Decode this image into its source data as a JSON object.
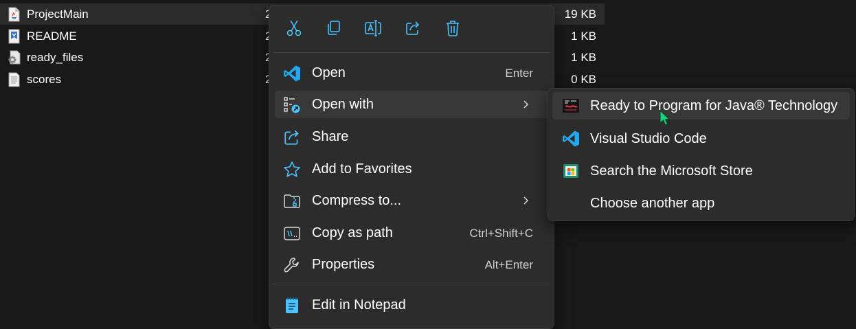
{
  "colors": {
    "background": "#191919",
    "menu_bg": "#2c2c2c",
    "hover_bg": "#383838",
    "vscode_blue": "#23a9f2",
    "icon_accent": "#4cc2ff",
    "cursor": "#17d47b"
  },
  "files": [
    {
      "name": "ProjectMain",
      "date": "2",
      "size": "19 KB",
      "icon": "java-file-icon",
      "selected": true
    },
    {
      "name": "README",
      "date": "2",
      "size": "1 KB",
      "icon": "readme-file-icon",
      "selected": false
    },
    {
      "name": "ready_files",
      "date": "2",
      "size": "1 KB",
      "icon": "settings-file-icon",
      "selected": false
    },
    {
      "name": "scores",
      "date": "2",
      "size": "0 KB",
      "icon": "text-file-icon",
      "selected": false
    }
  ],
  "toolbar": [
    {
      "name": "cut",
      "icon": "scissors-icon"
    },
    {
      "name": "copy",
      "icon": "copy-icon"
    },
    {
      "name": "rename",
      "icon": "rename-icon"
    },
    {
      "name": "share",
      "icon": "share-icon"
    },
    {
      "name": "delete",
      "icon": "trash-icon"
    }
  ],
  "menu": {
    "open": {
      "label": "Open",
      "shortcut": "Enter",
      "icon": "vscode-icon"
    },
    "open_with": {
      "label": "Open with",
      "icon": "open-with-icon",
      "has_submenu": true
    },
    "share": {
      "label": "Share",
      "icon": "share-icon"
    },
    "favorites": {
      "label": "Add to Favorites",
      "icon": "star-icon"
    },
    "compress": {
      "label": "Compress to...",
      "icon": "zip-folder-icon",
      "has_submenu": true
    },
    "copy_path": {
      "label": "Copy as path",
      "shortcut": "Ctrl+Shift+C",
      "icon": "path-icon"
    },
    "properties": {
      "label": "Properties",
      "shortcut": "Alt+Enter",
      "icon": "wrench-icon"
    },
    "notepad": {
      "label": "Edit in Notepad",
      "icon": "notepad-icon"
    }
  },
  "submenu": {
    "items": [
      {
        "label": "Ready to Program for Java® Technology",
        "icon": "ready-to-program-icon"
      },
      {
        "label": "Visual Studio Code",
        "icon": "vscode-icon"
      },
      {
        "label": "Search the Microsoft Store",
        "icon": "microsoft-store-icon"
      },
      {
        "label": "Choose another app",
        "icon": ""
      }
    ]
  }
}
